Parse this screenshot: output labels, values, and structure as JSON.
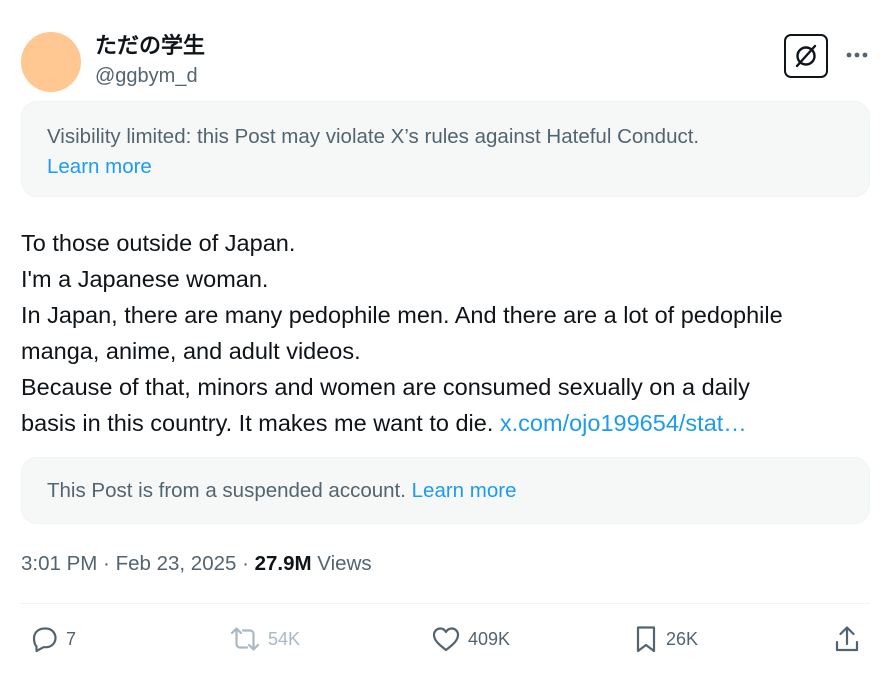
{
  "author": {
    "display_name": "ただの学生",
    "handle": "@ggbym_d",
    "avatar_color": "#ffc792"
  },
  "header_icons": [
    "grok-icon",
    "more-icon"
  ],
  "visibility_notice": {
    "text": "Visibility limited: this Post may violate X’s rules against Hateful Conduct.",
    "link": "Learn more"
  },
  "tweet": {
    "lines": [
      "To those outside of Japan.",
      "I'm a Japanese woman.",
      "In Japan, there are many pedophile men. And there are a lot of pedophile",
      "manga, anime, and adult videos.",
      "Because of that, minors and women are consumed sexually on a daily",
      "basis in this country. It makes me want to die. "
    ],
    "url": "x.com/ojo199654/stat…"
  },
  "quoted_notice": {
    "text": "This Post is from a suspended account. ",
    "link": "Learn more"
  },
  "meta": {
    "time": "3:01 PM",
    "sep1": " · ",
    "date": "Feb 23, 2025",
    "sep2": " · ",
    "views_count": "27.9M",
    "views_label": " Views"
  },
  "actions": {
    "replies": "7",
    "reposts": "54K",
    "likes": "409K",
    "bookmarks": "26K"
  },
  "colors": {
    "link": "#1d9bf0",
    "secondary_text": "#536471",
    "notice_bg": "#f6f8f8",
    "repost_muted": "#aab8c2"
  }
}
